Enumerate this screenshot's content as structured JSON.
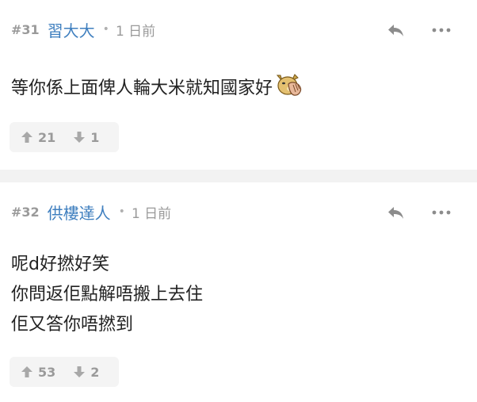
{
  "posts": [
    {
      "number": "#31",
      "username": "習大大",
      "separator": "•",
      "time": "1 日前",
      "lines": [
        "等你係上面俾人輪大米就知國家好"
      ],
      "emoji": "facepalm-dog-icon",
      "upvotes": "21",
      "downvotes": "1"
    },
    {
      "number": "#32",
      "username": "供樓達人",
      "separator": "•",
      "time": "1 日前",
      "lines": [
        "呢d好撚好笑",
        "你問返佢點解唔搬上去住",
        "佢又答你唔撚到"
      ],
      "upvotes": "53",
      "downvotes": "2"
    }
  ],
  "icons": {
    "reply": "reply-icon",
    "more": "more-dots-icon",
    "upvote": "arrow-up-icon",
    "downvote": "arrow-down-icon"
  },
  "colors": {
    "username": "#3f7fbf",
    "muted": "#9a9a9a",
    "vote_bg": "#f4f4f4",
    "divider": "#f2f2f2"
  }
}
